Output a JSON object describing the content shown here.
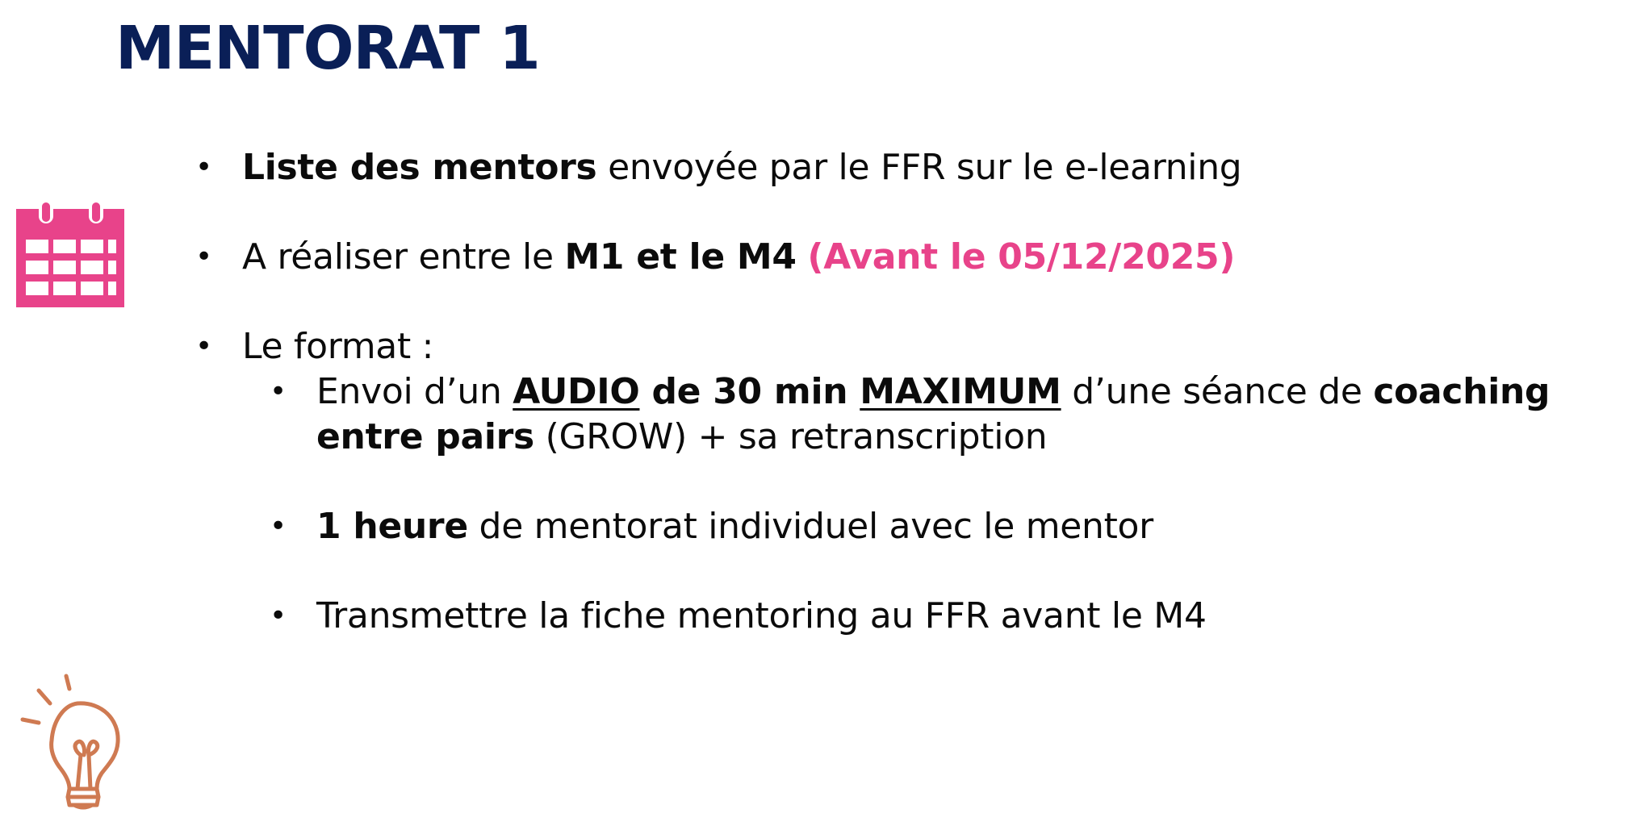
{
  "title": "MENTORAT 1",
  "colors": {
    "title": "#0a1f57",
    "accent_pink": "#e8438a",
    "bulb_orange": "#cf7a52",
    "text": "#0b0b0b"
  },
  "icons": {
    "calendar": "calendar-icon",
    "lightbulb": "lightbulb-icon"
  },
  "bullet_symbol": "•",
  "bullets": {
    "b1": {
      "bold": "Liste des mentors",
      "rest": " envoyée par le FFR sur le e-learning"
    },
    "b2": {
      "pre": "A réaliser entre le ",
      "bold": "M1 et le M4",
      "space": " ",
      "pink": "(Avant le 05/12/2025)"
    },
    "b3": {
      "text": "Le format :"
    },
    "s1": {
      "pre": "Envoi d’un ",
      "u1": "AUDIO",
      "mid_bold": " de 30 min ",
      "u2": "MAXIMUM",
      "mid": " d’une séance de ",
      "bold_end": "coaching",
      "line2_bold": "entre pairs",
      "line2_rest": " (GROW) + sa retranscription"
    },
    "s2": {
      "bold": "1 heure",
      "rest": " de mentorat individuel avec le mentor"
    },
    "s3": {
      "text": "Transmettre la fiche mentoring au FFR avant le M4"
    }
  }
}
